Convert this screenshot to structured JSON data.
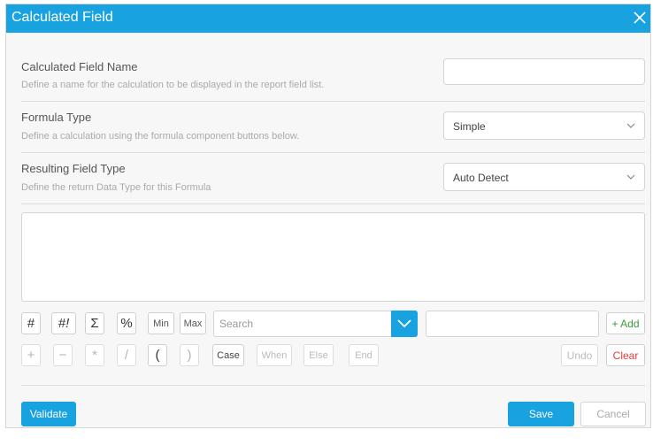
{
  "dialog": {
    "title": "Calculated Field",
    "close_icon": "close-icon"
  },
  "fields": {
    "name": {
      "label": "Calculated Field Name",
      "description": "Define a name for the calculation to be displayed in the report field list.",
      "value": ""
    },
    "formula_type": {
      "label": "Formula Type",
      "description": "Define a calculation using the formula component buttons below.",
      "selected": "Simple"
    },
    "result_type": {
      "label": "Resulting Field Type",
      "description": "Define the return Data Type for this Formula",
      "selected": "Auto Detect"
    }
  },
  "toolbar": {
    "row1": [
      "#",
      "#!",
      "Σ",
      "%",
      "Min",
      "Max"
    ],
    "search_placeholder": "Search",
    "add_label": "+ Add",
    "row2": [
      "+",
      "−",
      "*",
      "/",
      "(",
      ")",
      "Case",
      "When",
      "Else",
      "End"
    ],
    "undo_label": "Undo",
    "clear_label": "Clear"
  },
  "footer": {
    "validate_label": "Validate",
    "save_label": "Save",
    "cancel_label": "Cancel"
  },
  "colors": {
    "accent": "#19a2e0",
    "add_text": "#3a9a3a",
    "clear_text": "#e03a3a"
  }
}
